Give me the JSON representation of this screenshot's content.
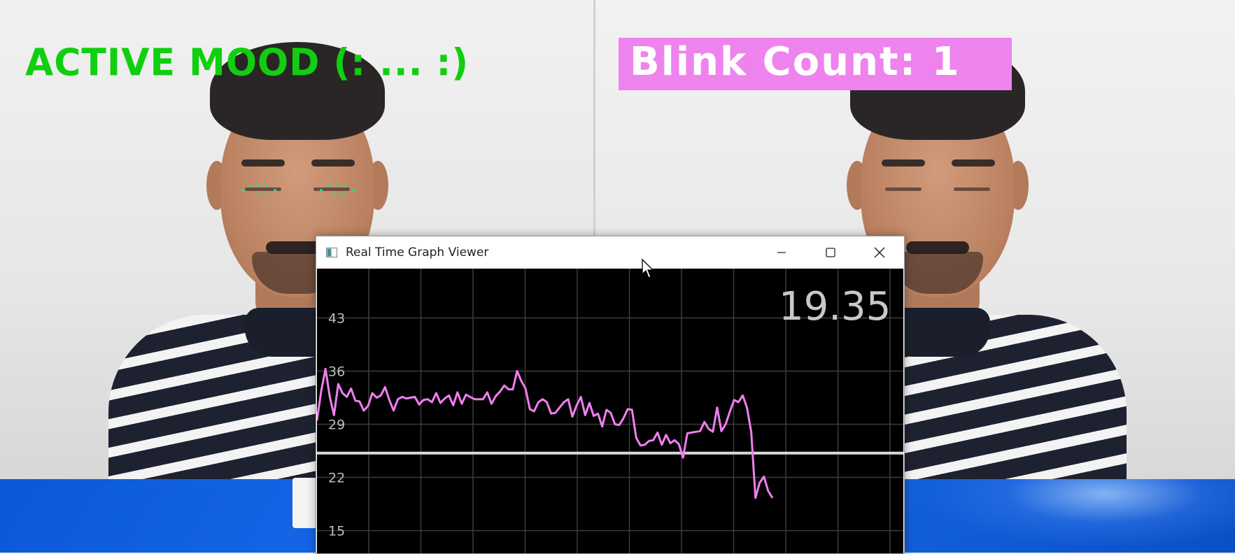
{
  "left_pane": {
    "overlay_text": "ACTIVE MOOD (: ... :)",
    "overlay_color": "#10cf10"
  },
  "right_pane": {
    "overlay_text": "Blink Count: 1",
    "overlay_bg": "#ef83ee",
    "overlay_color": "#ffffff"
  },
  "graph_window": {
    "title": "Real Time Graph Viewer",
    "icon": "app-window-icon",
    "controls": {
      "minimize": "minimize-icon",
      "maximize": "maximize-icon",
      "close": "close-icon"
    },
    "readout": "19.35"
  },
  "chart_data": {
    "type": "line",
    "yticks": [
      "43",
      "36",
      "29",
      "22",
      "15"
    ],
    "ytick_values": [
      43,
      36,
      29,
      22,
      15
    ],
    "ylim": [
      12,
      49.5
    ],
    "threshold": 25.2,
    "grid": true,
    "line_color": "#f07ef0",
    "threshold_color": "#d8d8d8",
    "values": [
      29.5,
      33.4,
      36.3,
      32.6,
      30.2,
      34.3,
      33.1,
      32.6,
      33.7,
      32.1,
      32.0,
      30.8,
      31.4,
      33.1,
      32.5,
      32.8,
      33.9,
      32.2,
      30.8,
      32.3,
      32.6,
      32.4,
      32.5,
      32.6,
      31.6,
      32.2,
      32.3,
      31.9,
      33.1,
      31.8,
      32.4,
      32.8,
      31.5,
      33.2,
      31.7,
      32.9,
      32.6,
      32.3,
      32.3,
      32.3,
      33.2,
      31.7,
      32.7,
      33.3,
      34.1,
      33.6,
      33.6,
      36.0,
      34.7,
      33.7,
      31.0,
      30.7,
      31.9,
      32.3,
      31.9,
      30.4,
      30.5,
      31.2,
      31.9,
      32.3,
      30.0,
      31.5,
      32.6,
      30.2,
      31.8,
      30.1,
      30.4,
      28.7,
      30.9,
      30.5,
      29.0,
      28.9,
      29.8,
      31.0,
      30.9,
      27.2,
      26.2,
      26.3,
      26.8,
      26.9,
      27.9,
      26.3,
      27.6,
      26.5,
      26.9,
      26.4,
      24.6,
      27.8,
      27.9,
      28.0,
      28.1,
      29.3,
      28.4,
      28.0,
      31.2,
      28.1,
      29.0,
      30.7,
      32.2,
      31.9,
      32.8,
      31.2,
      28.0,
      19.3,
      21.3,
      22.1,
      20.2,
      19.3
    ]
  }
}
